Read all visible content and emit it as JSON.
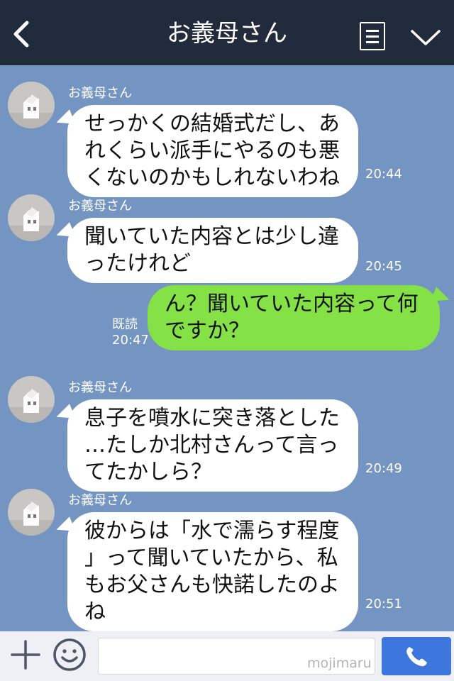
{
  "header": {
    "title": "お義母さん",
    "back_icon": "back-chevron-icon",
    "menu_icon": "notes-menu-icon",
    "expand_icon": "chevron-down-icon"
  },
  "messages": [
    {
      "sender": "お義母さん",
      "lines": [
        "せっかくの結婚式だし、あ",
        "れくらい派手にやるのも悪",
        "くないのかもしれないわね"
      ],
      "time": "20:44"
    },
    {
      "sender": "お義母さん",
      "lines": [
        "聞いていた内容とは少し違",
        "ったけれど"
      ],
      "time": "20:45"
    },
    {
      "lines": [
        "ん？聞いていた内容って何",
        "ですか？"
      ],
      "read_label": "既読",
      "time": "20:47"
    },
    {
      "sender": "お義母さん",
      "lines": [
        "息子を噴水に突き落とした",
        "…たしか北村さんって言っ",
        "てたかしら？"
      ],
      "time": "20:49"
    },
    {
      "sender": "お義母さん",
      "lines": [
        "彼からは「水で濡らす程度",
        "」って聞いていたから、私",
        "もお父さんも快諾したのよ",
        "ね"
      ],
      "time": "20:51"
    }
  ],
  "footer": {
    "plus_icon": "plus-icon",
    "emoji_icon": "smiley-icon",
    "send_icon": "phone-icon",
    "watermark": "mojimaru"
  },
  "colors": {
    "header_bg": "#222b3b",
    "chat_bg": "#7494c2",
    "incoming_bubble": "#ffffff",
    "outgoing_bubble": "#84e247",
    "send_button": "#3d76dc"
  }
}
